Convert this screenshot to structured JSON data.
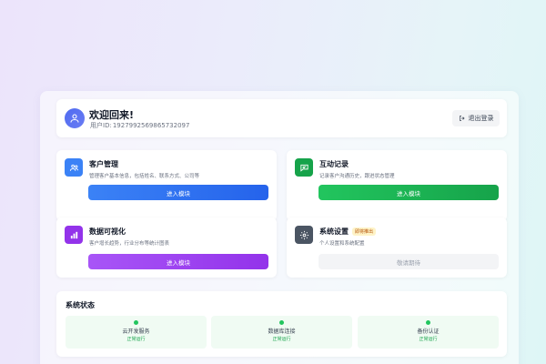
{
  "header": {
    "welcome": "欢迎回来!",
    "user_id_label": "用户ID:",
    "user_id_value": "1927992569865732097",
    "logout_label": "退出登录"
  },
  "modules": [
    {
      "title": "客户管理",
      "desc": "管理客户基本信息，包括姓名、联系方式、公司等",
      "button": "进入模块",
      "icon": "customers-icon",
      "color": "#3b82f6"
    },
    {
      "title": "互动记录",
      "desc": "记录客户沟通历史，跟进状态管理",
      "button": "进入模块",
      "icon": "chat-icon",
      "color": "#16a34a"
    },
    {
      "title": "数据可视化",
      "desc": "客户增长趋势，行业分布等统计图表",
      "button": "进入模块",
      "icon": "bar-chart-icon",
      "color": "#9333ea"
    },
    {
      "title": "系统设置",
      "badge": "即将推出",
      "desc": "个人设置和系统配置",
      "button": "敬请期待",
      "icon": "gear-icon",
      "color": "#4b5563"
    }
  ],
  "status": {
    "title": "系统状态",
    "items": [
      {
        "name": "云开发服务",
        "state": "正常运行"
      },
      {
        "name": "数据库连接",
        "state": "正常运行"
      },
      {
        "name": "备份认证",
        "state": "正常运行"
      }
    ]
  }
}
